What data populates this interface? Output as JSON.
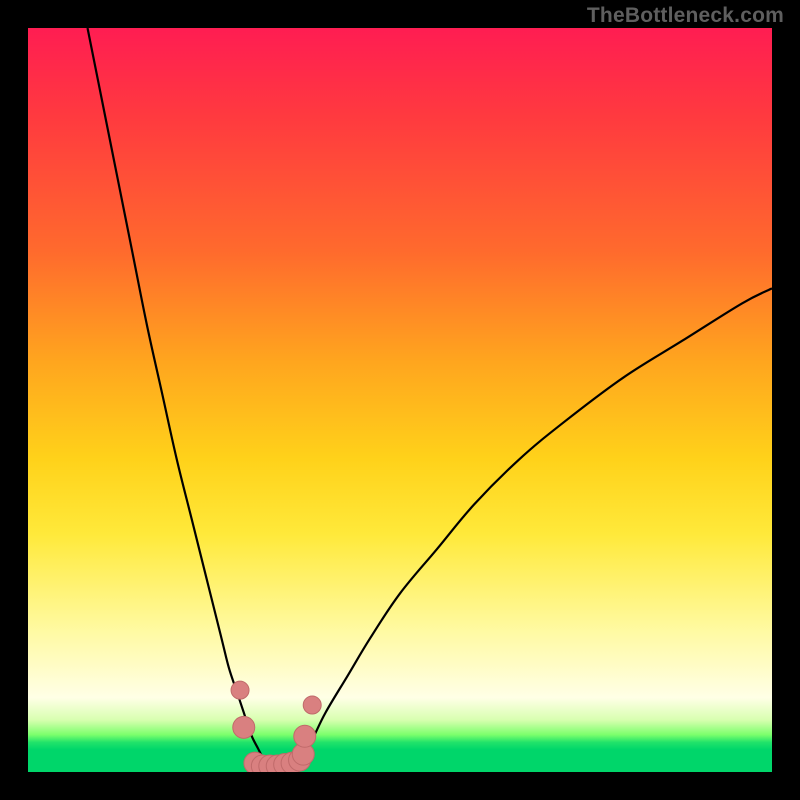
{
  "watermark": "TheBottleneck.com",
  "colors": {
    "frame": "#000000",
    "curve": "#000000",
    "marker_fill": "#d98080",
    "marker_stroke": "#c06a6a"
  },
  "chart_data": {
    "type": "line",
    "title": "",
    "xlabel": "",
    "ylabel": "",
    "xlim": [
      0,
      100
    ],
    "ylim": [
      0,
      100
    ],
    "note": "Values estimated from pixel positions; axes unlabeled in source image. y ≈ bottleneck %, valley ≈ optimal match.",
    "series": [
      {
        "name": "left-branch",
        "x": [
          8,
          10,
          12,
          14,
          16,
          18,
          20,
          22,
          24,
          26,
          27,
          28,
          29,
          30,
          31,
          32
        ],
        "y": [
          100,
          90,
          80,
          70,
          60,
          51,
          42,
          34,
          26,
          18,
          14,
          11,
          8,
          5,
          3,
          1
        ]
      },
      {
        "name": "right-branch",
        "x": [
          36,
          38,
          40,
          43,
          46,
          50,
          55,
          60,
          66,
          72,
          80,
          88,
          96,
          100
        ],
        "y": [
          1,
          4,
          8,
          13,
          18,
          24,
          30,
          36,
          42,
          47,
          53,
          58,
          63,
          65
        ]
      }
    ],
    "markers": {
      "name": "valley-points",
      "x": [
        28.5,
        29.0,
        30.5,
        31.5,
        32.5,
        33.5,
        34.5,
        35.5,
        36.5,
        37.0,
        37.2,
        38.2
      ],
      "y": [
        11.0,
        6.0,
        1.2,
        0.8,
        0.8,
        0.8,
        1.0,
        1.2,
        1.6,
        2.4,
        4.8,
        9.0
      ]
    }
  }
}
